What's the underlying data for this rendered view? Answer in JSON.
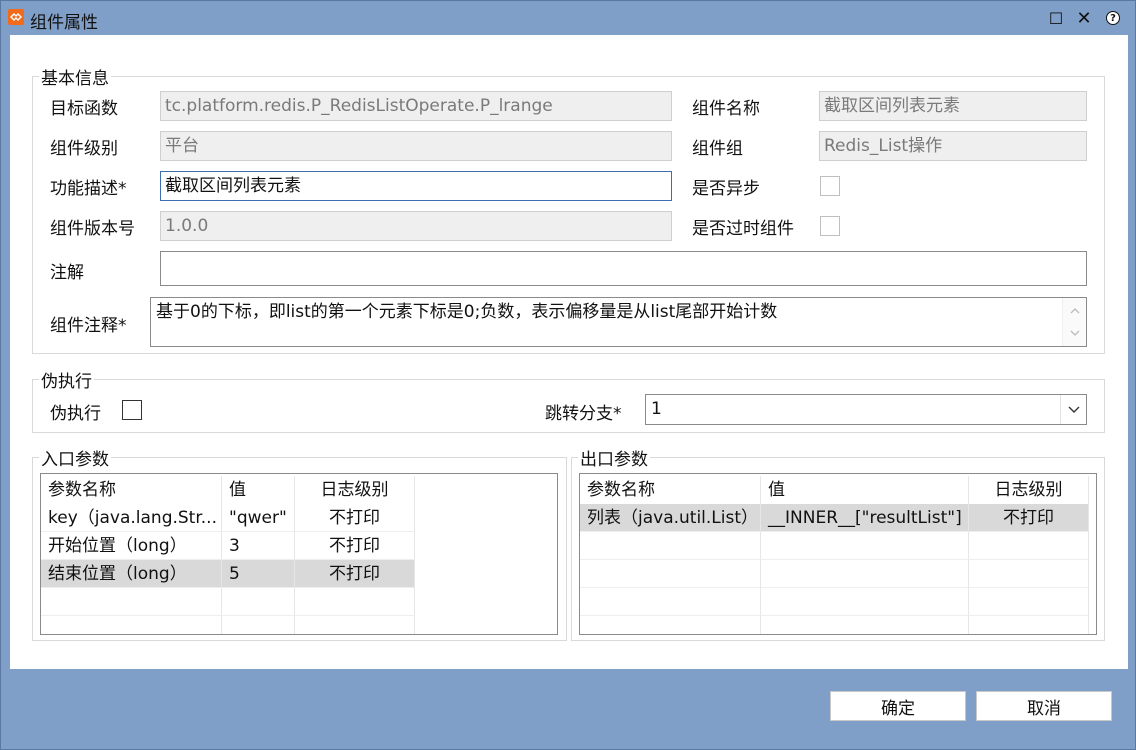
{
  "window": {
    "title": "组件属性",
    "maximize_glyph": "☐",
    "close_glyph": "✕",
    "help_glyph": "?"
  },
  "basic_info": {
    "legend": "基本信息",
    "target_function": {
      "label": "目标函数",
      "value": "tc.platform.redis.P_RedisListOperate.P_lrange"
    },
    "component_name": {
      "label": "组件名称",
      "value": "截取区间列表元素"
    },
    "component_level": {
      "label": "组件级别",
      "value": "平台"
    },
    "component_group": {
      "label": "组件组",
      "value": "Redis_List操作"
    },
    "description": {
      "label": "功能描述*",
      "value": "截取区间列表元素"
    },
    "is_async": {
      "label": "是否异步",
      "checked": false
    },
    "version": {
      "label": "组件版本号",
      "value": "1.0.0"
    },
    "is_deprecated": {
      "label": "是否过时组件",
      "checked": false
    },
    "annotation": {
      "label": "注解",
      "value": ""
    },
    "component_comment": {
      "label": "组件注释*",
      "value": "基于0的下标，即list的第一个元素下标是0;负数，表示偏移量是从list尾部开始计数"
    }
  },
  "pseudo_exec": {
    "legend": "伪执行",
    "checkbox_label": "伪执行",
    "checked": false,
    "jump_branch": {
      "label": "跳转分支*",
      "value": "1"
    }
  },
  "input_params": {
    "legend": "入口参数",
    "headers": [
      "参数名称",
      "值",
      "日志级别"
    ],
    "rows": [
      {
        "name": "key（java.lang.Str...",
        "value": "\"qwer\"",
        "log": "不打印"
      },
      {
        "name": "开始位置（long）",
        "value": "3",
        "log": "不打印"
      },
      {
        "name": "结束位置（long）",
        "value": "5",
        "log": "不打印"
      }
    ]
  },
  "output_params": {
    "legend": "出口参数",
    "headers": [
      "参数名称",
      "值",
      "日志级别"
    ],
    "rows": [
      {
        "name": "列表（java.util.List）",
        "value": "__INNER__[\"resultList\"]",
        "log": "不打印"
      }
    ]
  },
  "buttons": {
    "ok": "确定",
    "cancel": "取消"
  },
  "colors": {
    "frame": "#7f9ec8",
    "title_icon": "#f26b1d",
    "selected_row": "#d9d9d9"
  }
}
